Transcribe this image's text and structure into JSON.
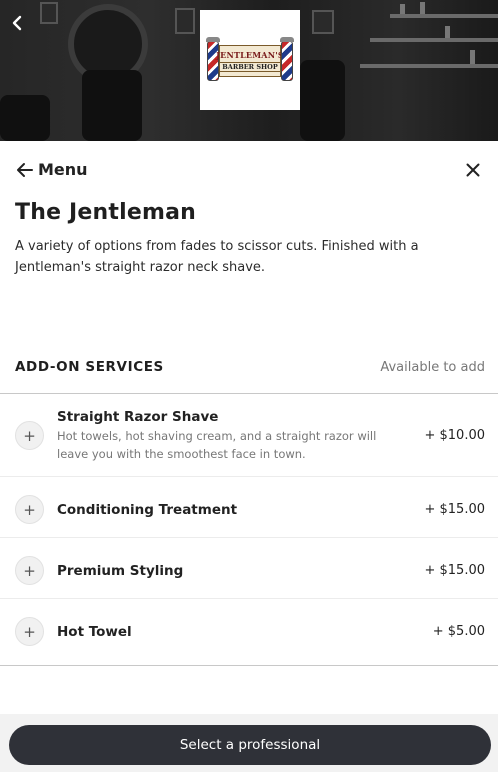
{
  "header": {
    "logo_line1": "JENTLEMAN'S",
    "logo_line2": "BARBER SHOP"
  },
  "nav": {
    "menu_label": "Menu"
  },
  "service": {
    "title": "The Jentleman",
    "description": "A variety of options from fades to scissor cuts. Finished with a Jentleman's straight razor neck shave."
  },
  "addons": {
    "heading": "ADD-ON SERVICES",
    "availability": "Available to add",
    "items": [
      {
        "name": "Straight Razor Shave",
        "description": "Hot towels, hot shaving cream, and a straight razor will leave you with the smoothest face in town.",
        "price": "+ $10.00"
      },
      {
        "name": "Conditioning Treatment",
        "description": "",
        "price": "+ $15.00"
      },
      {
        "name": "Premium Styling",
        "description": "",
        "price": "+ $15.00"
      },
      {
        "name": "Hot Towel",
        "description": "",
        "price": "+ $5.00"
      }
    ]
  },
  "footer": {
    "cta_label": "Select a professional"
  },
  "icons": {
    "back": "chevron-left-icon",
    "menu_back": "arrow-left-icon",
    "close": "close-icon",
    "add": "plus-icon"
  },
  "colors": {
    "cta_background": "#2f3138",
    "accent_text": "#222222"
  }
}
